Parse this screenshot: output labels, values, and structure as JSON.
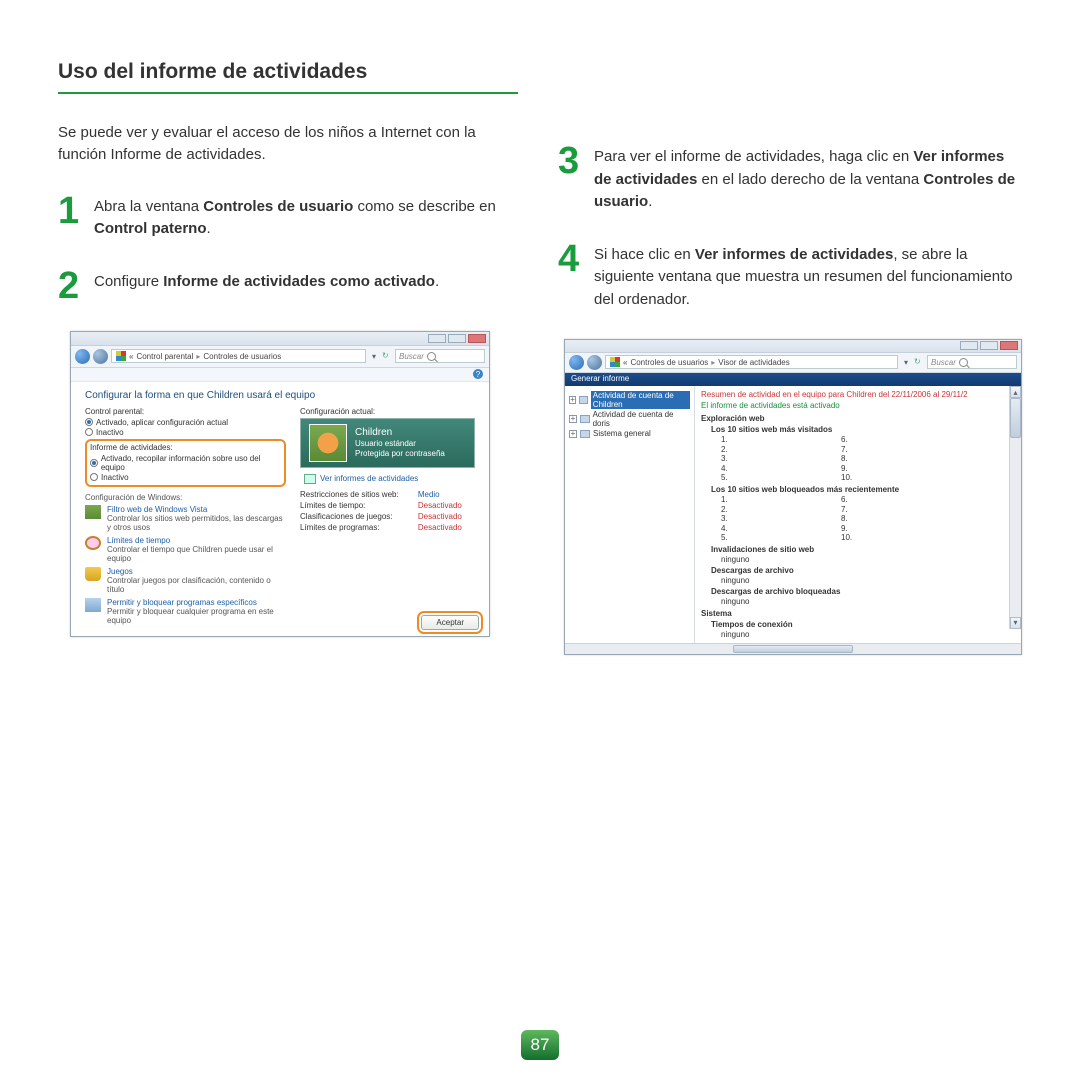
{
  "section_title": "Uso del informe de actividades",
  "intro": "Se puede ver y evaluar el acceso de los niños a Internet con la función Informe de actividades.",
  "step1": {
    "num": "1",
    "pre": "Abra la ventana ",
    "b1": "Controles de usuario",
    "mid": " como se describe en ",
    "b2": "Control paterno",
    "post": "."
  },
  "step2": {
    "num": "2",
    "pre": "Configure ",
    "b1": "Informe de actividades como activado",
    "post": "."
  },
  "step3": {
    "num": "3",
    "pre": "Para ver el informe de actividades, haga clic en ",
    "b1": "Ver informes de actividades",
    "mid": " en el lado derecho de la ventana ",
    "b2": "Controles de usuario",
    "post": "."
  },
  "step4": {
    "num": "4",
    "pre": "Si hace clic en ",
    "b1": "Ver informes de actividades",
    "post": ", se abre la siguiente ventana que muestra un resumen del funcionamiento del ordenador."
  },
  "shot1": {
    "bc1": "Control parental",
    "bc2": "Controles de usuarios",
    "search_placeholder": "Buscar",
    "heading": "Configurar la forma en que Children usará el equipo",
    "group_parental": "Control parental:",
    "radio_on": "Activado, aplicar configuración actual",
    "radio_off": "Inactivo",
    "group_report": "Informe de actividades:",
    "radio_report_on": "Activado, recopilar información sobre uso del equipo",
    "radio_report_off": "Inactivo",
    "right_heading": "Configuración actual:",
    "user_name": "Children",
    "user_type": "Usuario estándar",
    "user_pwd": "Protegida por contraseña",
    "view_reports": "Ver informes de actividades",
    "winconfig": "Configuración de Windows:",
    "cfg_webfilter": "Filtro web de Windows Vista",
    "cfg_webfilter_sub": "Controlar los sitios web permitidos, las descargas y otros usos",
    "cfg_timelimit": "Límites de tiempo",
    "cfg_timelimit_sub": "Controlar el tiempo que Children puede usar el equipo",
    "cfg_games": "Juegos",
    "cfg_games_sub": "Controlar juegos por clasificación, contenido o título",
    "cfg_programs": "Permitir y bloquear programas específicos",
    "cfg_programs_sub": "Permitir y bloquear cualquier programa en este equipo",
    "set_restrict": "Restricciones de sitios web:",
    "set_restrict_val": "Medio",
    "set_time": "Límites de tiempo:",
    "set_time_val": "Desactivado",
    "set_gamecls": "Clasificaciones de juegos:",
    "set_gamecls_val": "Desactivado",
    "set_proglim": "Límites de programas:",
    "set_proglim_val": "Desactivado",
    "accept": "Aceptar"
  },
  "shot2": {
    "bc1": "Controles de usuarios",
    "bc2": "Visor de actividades",
    "search_placeholder": "Buscar",
    "menu_generate": "Generar informe",
    "tree_children": "Actividad de cuenta de Children",
    "tree_doris": "Actividad de cuenta de doris",
    "tree_system": "Sistema general",
    "summary": "Resumen de actividad en el equipo para Children del 22/11/2006 al 29/11/2",
    "status": "El informe de actividades está activado",
    "sec_web": "Exploración web",
    "sub_top10": "Los 10 sitios web más visitados",
    "sub_top10block": "Los 10 sitios web bloqueados más recientemente",
    "sub_overrides": "Invalidaciones de sitio web",
    "sub_downloads": "Descargas de archivo",
    "sub_dlblocked": "Descargas de archivo bloqueadas",
    "none": "ninguno",
    "sec_system": "Sistema",
    "sub_conntimes": "Tiempos de conexión",
    "col1": [
      "1.",
      "2.",
      "3.",
      "4.",
      "5."
    ],
    "col2": [
      "6.",
      "7.",
      "8.",
      "9.",
      "10."
    ]
  },
  "page_number": "87"
}
